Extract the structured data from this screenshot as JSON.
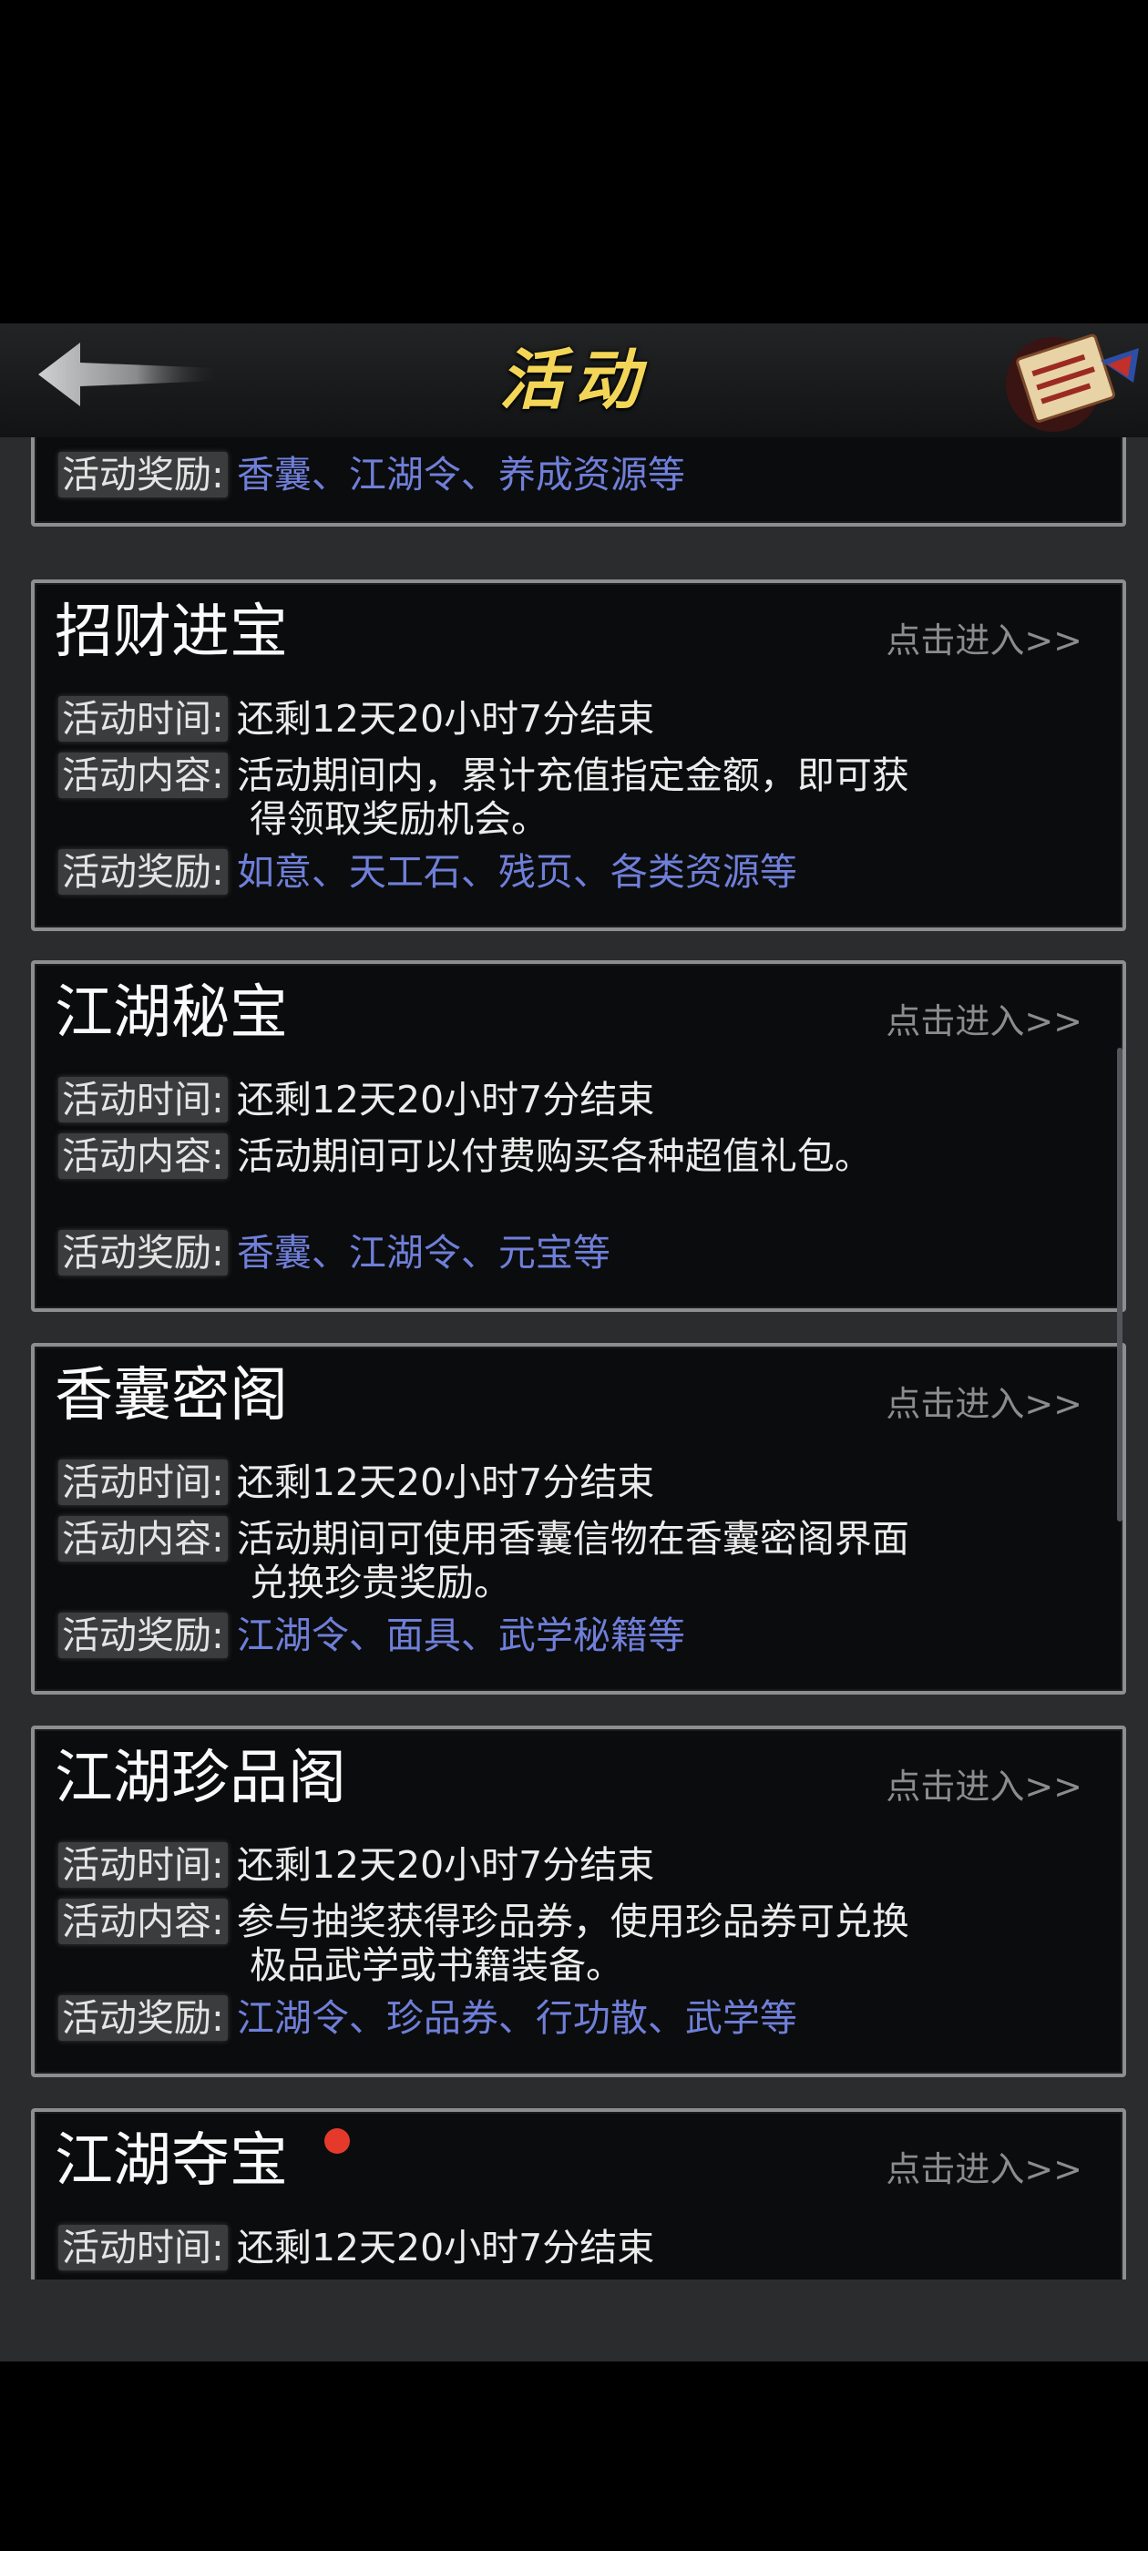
{
  "header": {
    "title": "活动"
  },
  "enter_label": "点击进入>>",
  "labels": {
    "time": "活动时间:",
    "content": "活动内容:",
    "reward": "活动奖励:"
  },
  "top_partial": {
    "reward": "香囊、江湖令、养成资源等"
  },
  "cards": [
    {
      "title": "招财进宝",
      "time": "还剩12天20小时7分结束",
      "content": [
        "活动期间内，累计充值指定金额，即可获",
        "得领取奖励机会。"
      ],
      "reward": "如意、天工石、残页、各类资源等"
    },
    {
      "title": "江湖秘宝",
      "time": "还剩12天20小时7分结束",
      "content": [
        "活动期间可以付费购买各种超值礼包。"
      ],
      "reward": "香囊、江湖令、元宝等"
    },
    {
      "title": "香囊密阁",
      "time": "还剩12天20小时7分结束",
      "content": [
        "活动期间可使用香囊信物在香囊密阁界面",
        "兑换珍贵奖励。"
      ],
      "reward": "江湖令、面具、武学秘籍等"
    },
    {
      "title": "江湖珍品阁",
      "time": "还剩12天20小时7分结束",
      "content": [
        "参与抽奖获得珍品券，使用珍品券可兑换",
        "极品武学或书籍装备。"
      ],
      "reward": "江湖令、珍品券、行功散、武学等"
    },
    {
      "title": "江湖夺宝",
      "time": "还剩12天20小时7分结束",
      "has_new": true
    }
  ],
  "colors": {
    "title": "#f3d658",
    "reward": "#6f7fd9",
    "new_dot": "#e53a2b"
  }
}
